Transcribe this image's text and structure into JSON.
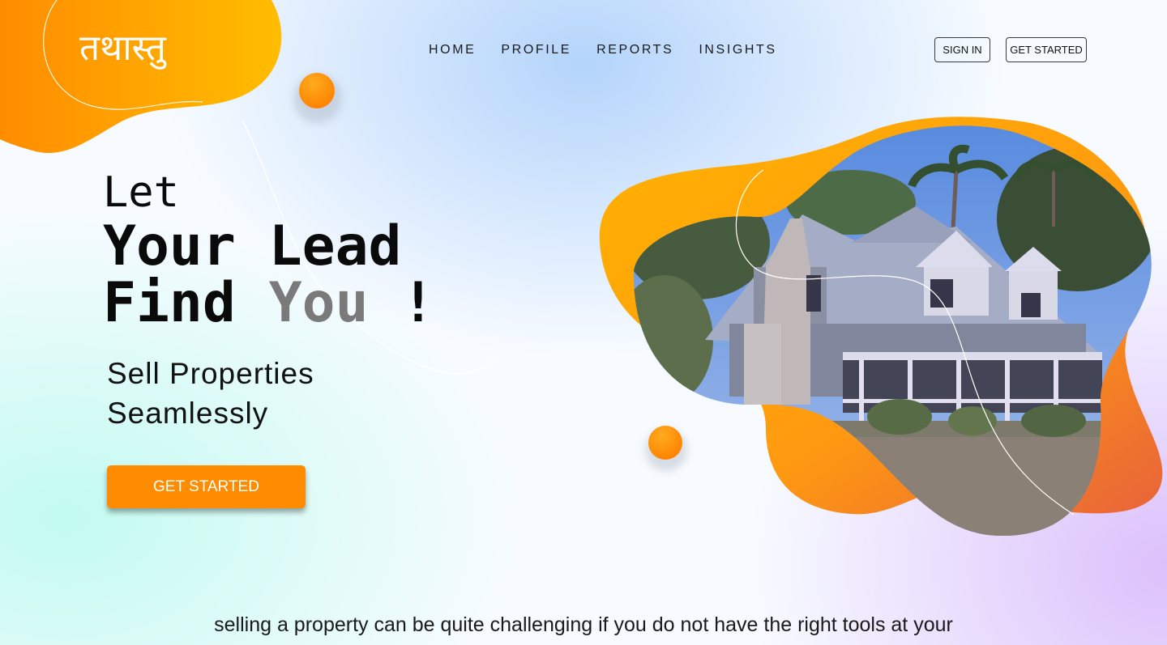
{
  "brand": {
    "logo_text": "तथास्तु"
  },
  "nav": {
    "items": [
      {
        "label": "HOME"
      },
      {
        "label": "PROFILE"
      },
      {
        "label": "REPORTS"
      },
      {
        "label": "INSIGHTS"
      }
    ]
  },
  "header": {
    "sign_in_label": "SIGN IN",
    "get_started_label": "GET STARTED"
  },
  "hero": {
    "line1": "Let",
    "line2": "Your Lead",
    "line3_prefix": "Find ",
    "line3_highlight": "You",
    "line3_suffix": " !",
    "tagline_line1": "Sell Properties",
    "tagline_line2": "Seamlessly",
    "cta_label": "GET STARTED",
    "image_icon": "house-photo"
  },
  "intro": {
    "text": "selling a property can be quite challenging if you do not have the right tools at your"
  },
  "colors": {
    "accent": "#ff8c00",
    "accent_light": "#ffb300",
    "highlight_text": "#7a7a7a",
    "text": "#0a0a0a"
  }
}
